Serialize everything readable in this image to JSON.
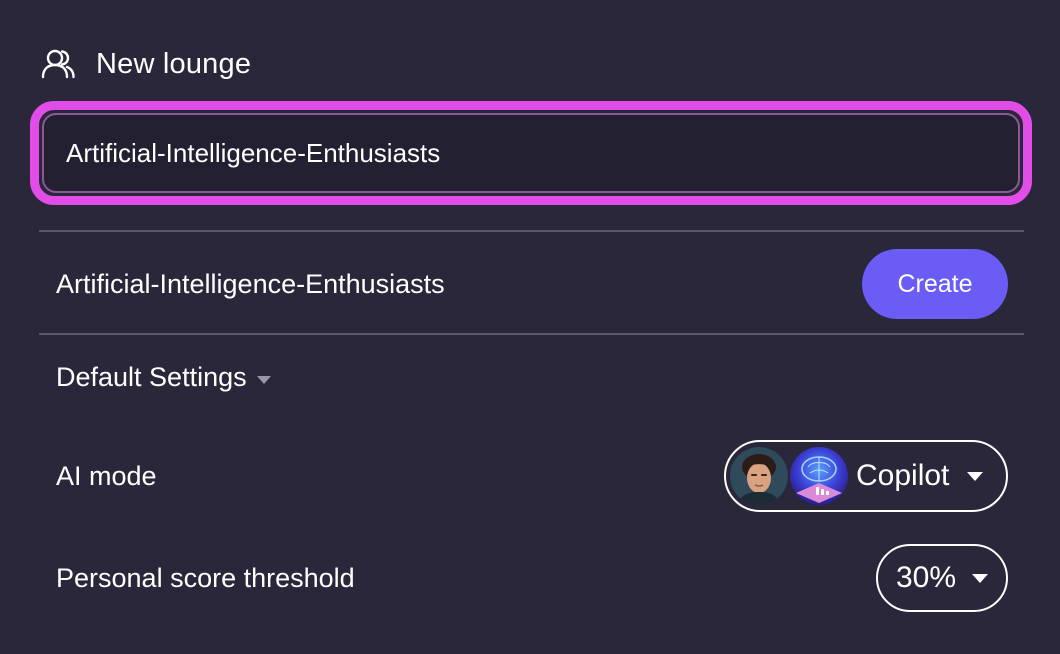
{
  "header": {
    "icon": "users-icon",
    "title": "New lounge"
  },
  "search": {
    "value": "Artificial-Intelligence-Enthusiasts",
    "focus_color": "#e24de8"
  },
  "result": {
    "name": "Artificial-Intelligence-Enthusiasts",
    "create_label": "Create",
    "button_color": "#6a5cf5"
  },
  "settings": {
    "toggle_label": "Default Settings",
    "ai_mode": {
      "label": "AI mode",
      "value": "Copilot",
      "avatars": [
        "person-avatar",
        "ai-brain-avatar"
      ]
    },
    "score_threshold": {
      "label": "Personal score threshold",
      "value": "30%"
    }
  },
  "colors": {
    "background": "#2a273b",
    "divider": "#5b586b"
  }
}
